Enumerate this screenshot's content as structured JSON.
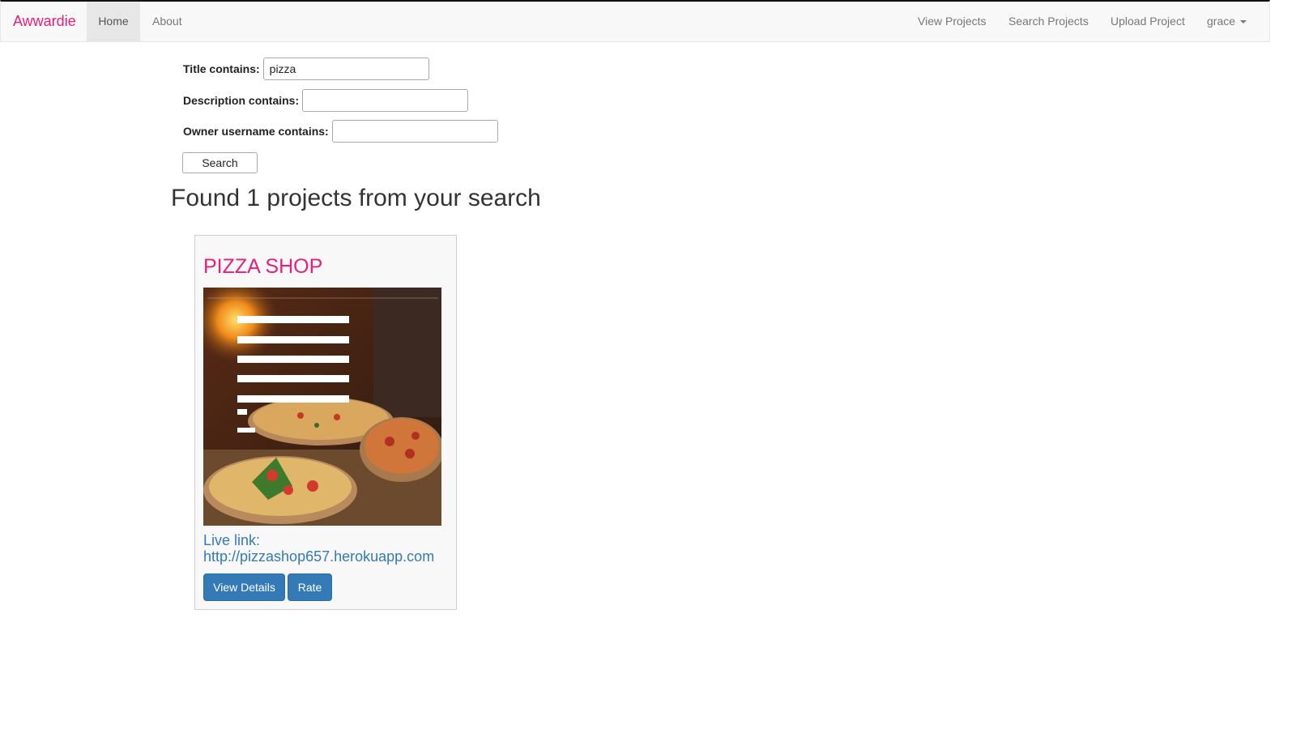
{
  "navbar": {
    "brand": "Awwardie",
    "left_items": [
      "Home",
      "About"
    ],
    "right_items": [
      "View Projects",
      "Search Projects",
      "Upload Project"
    ],
    "user": "grace",
    "brand_color": "#e91e7a"
  },
  "search_form": {
    "title_label": "Title contains:",
    "title_value": "pizza",
    "description_label": "Description contains:",
    "description_value": "",
    "owner_label": "Owner username contains:",
    "owner_value": "",
    "submit_label": "Search"
  },
  "results": {
    "heading": "Found 1 projects from your search",
    "projects": [
      {
        "title": "PIZZA SHOP",
        "screenshot": "pizza-website-screenshot",
        "live_link_label": "Live link:",
        "live_link_url": "http://pizzashop657.herokuapp.com",
        "view_details_label": "View Details",
        "rate_label": "Rate"
      }
    ]
  }
}
